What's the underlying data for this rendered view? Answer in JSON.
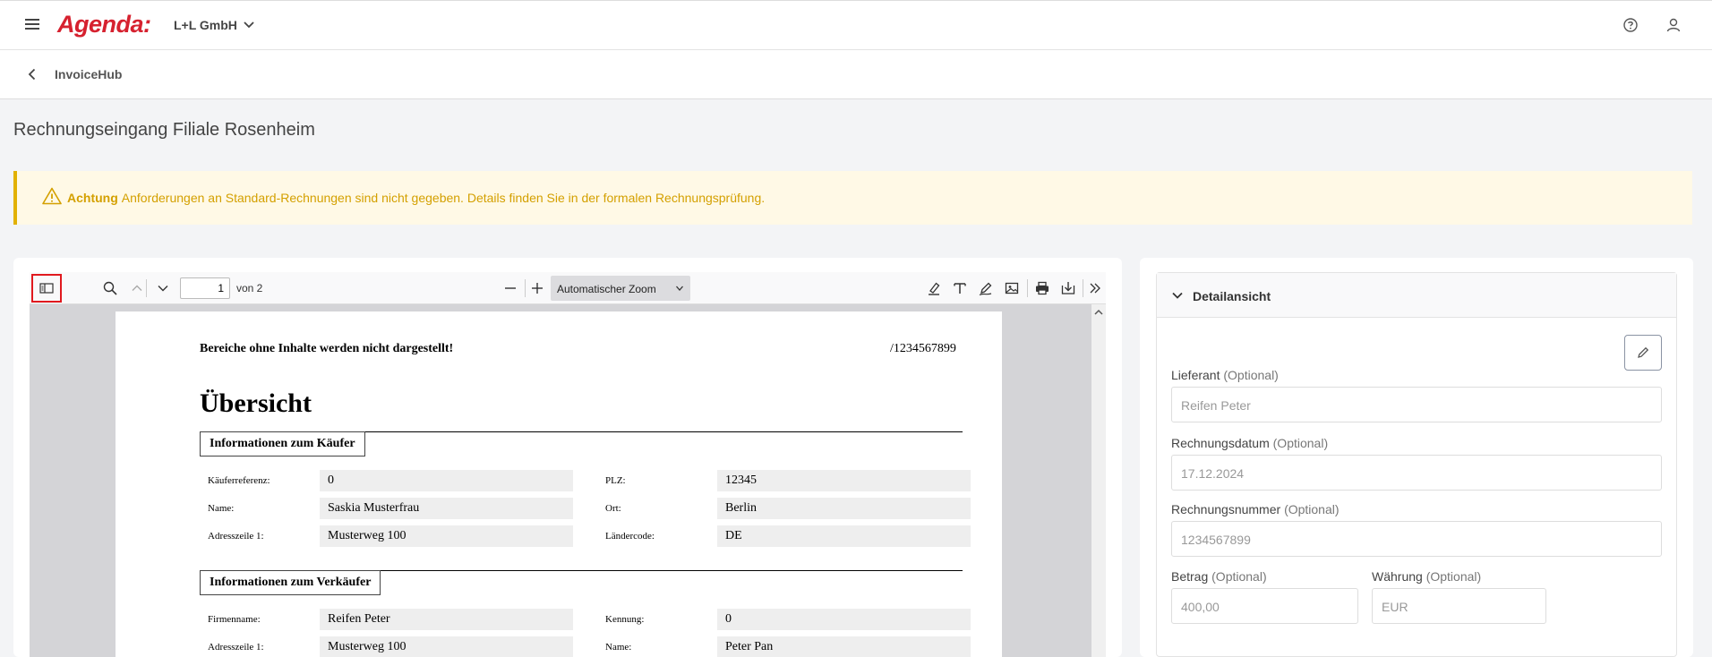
{
  "header": {
    "logo": "Agenda:",
    "company": "L+L GmbH",
    "icons": [
      "menu-icon",
      "help-icon",
      "user-icon"
    ]
  },
  "subheader": {
    "title": "InvoiceHub"
  },
  "page": {
    "title": "Rechnungseingang Filiale Rosenheim"
  },
  "alert": {
    "label": "Achtung",
    "text": "Anforderungen an Standard-Rechnungen sind nicht gegeben. Details finden Sie in der formalen Rechnungsprüfung."
  },
  "pdf_toolbar": {
    "page_current": "1",
    "page_of": "von 2",
    "zoom": "Automatischer Zoom"
  },
  "pdf_document": {
    "note": "Bereiche ohne Inhalte werden nicht dargestellt!",
    "doc_number": "/1234567899",
    "heading": "Übersicht",
    "buyer_section": {
      "title": "Informationen zum Käufer",
      "fields": [
        {
          "label": "Käuferreferenz:",
          "value": "0"
        },
        {
          "label": "PLZ:",
          "value": "12345"
        },
        {
          "label": "Name:",
          "value": "Saskia Musterfrau"
        },
        {
          "label": "Ort:",
          "value": "Berlin"
        },
        {
          "label": "Adresszeile 1:",
          "value": "Musterweg 100"
        },
        {
          "label": "Ländercode:",
          "value": "DE"
        }
      ]
    },
    "seller_section": {
      "title": "Informationen zum Verkäufer",
      "fields": [
        {
          "label": "Firmenname:",
          "value": "Reifen Peter"
        },
        {
          "label": "Kennung:",
          "value": "0"
        },
        {
          "label": "Adresszeile 1:",
          "value": "Musterweg 100"
        },
        {
          "label": "Name:",
          "value": "Peter Pan"
        }
      ]
    }
  },
  "detail": {
    "title": "Detailansicht",
    "optional": "(Optional)",
    "fields": {
      "lieferant": {
        "label": "Lieferant",
        "value": "Reifen Peter"
      },
      "rechnungsdatum": {
        "label": "Rechnungsdatum",
        "value": "17.12.2024"
      },
      "rechnungsnummer": {
        "label": "Rechnungsnummer",
        "value": "1234567899"
      },
      "betrag": {
        "label": "Betrag",
        "value": "400,00"
      },
      "waehrung": {
        "label": "Währung",
        "value": "EUR"
      }
    }
  },
  "colors": {
    "brand": "#d6212f",
    "warning": "#d4a000",
    "highlight": "#e0191e"
  }
}
